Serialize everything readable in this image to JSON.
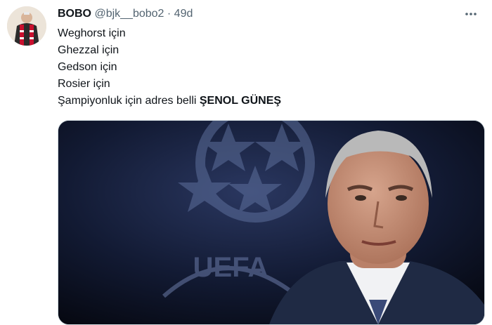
{
  "tweet": {
    "author_name": "BOBO",
    "handle": "@bjk__bobo2",
    "separator": "·",
    "time": "49d",
    "lines": [
      "Weghorst için",
      "Ghezzal için",
      "Gedson için",
      "Rosier için"
    ],
    "last_line_prefix": "Şampiyonluk için adres belli ",
    "last_line_bold": "ŞENOL GÜNEŞ"
  },
  "media": {
    "logo_text": "UEFA"
  },
  "icons": {
    "more": "more-horizontal-icon",
    "avatar": "user-avatar"
  }
}
